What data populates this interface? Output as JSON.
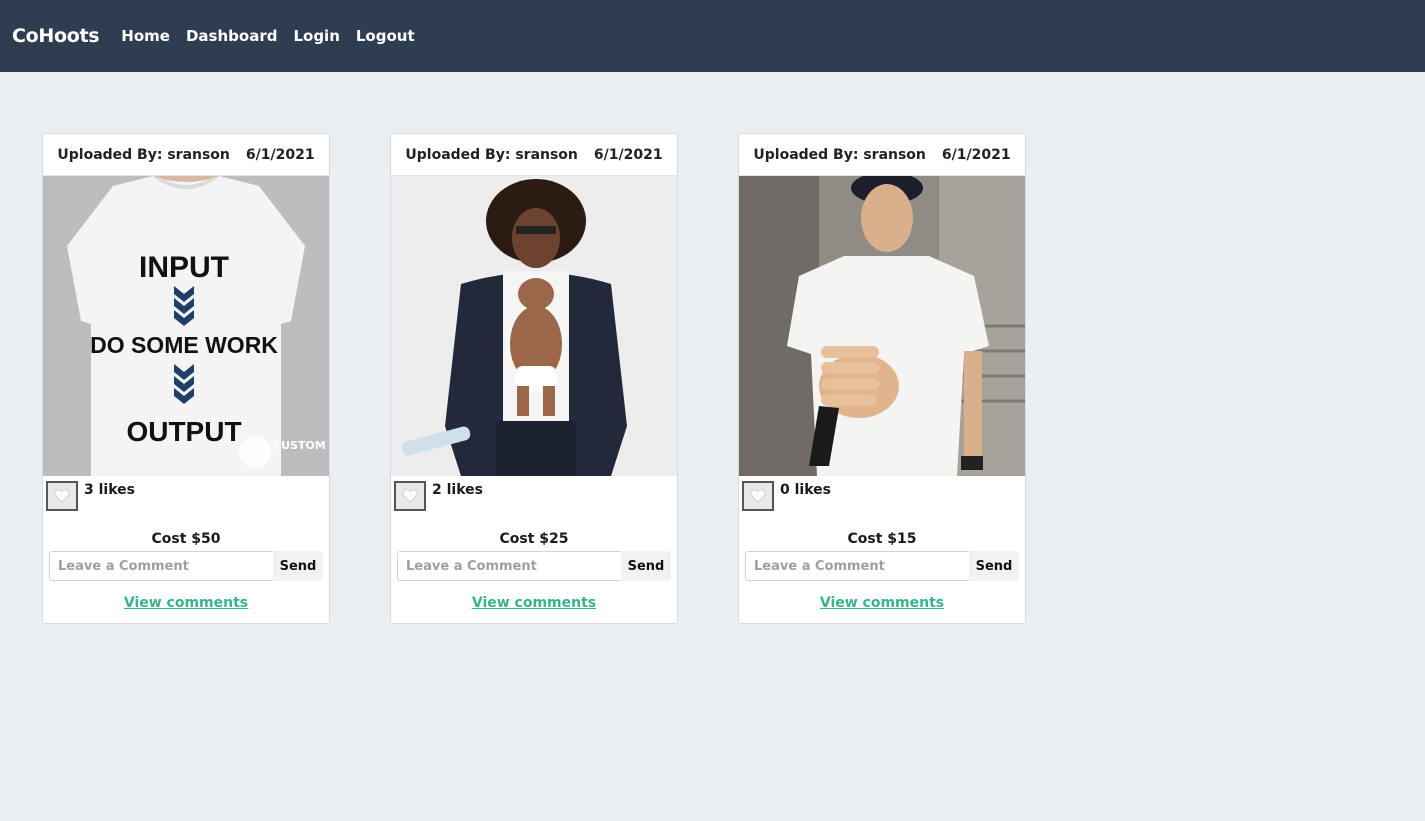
{
  "nav": {
    "brand": "CoHoots",
    "links": [
      "Home",
      "Dashboard",
      "Login",
      "Logout"
    ]
  },
  "cards": [
    {
      "uploaded_by": "Uploaded By: sranson",
      "date": "6/1/2021",
      "shirt_lines": [
        "INPUT",
        "DO SOME WORK",
        "OUTPUT"
      ],
      "watermark": "CUSTOM INK",
      "likes": "3 likes",
      "cost": "Cost $50",
      "comment_placeholder": "Leave a Comment",
      "send_label": "Send",
      "view_comments": "View comments"
    },
    {
      "uploaded_by": "Uploaded By: sranson",
      "date": "6/1/2021",
      "likes": "2 likes",
      "cost": "Cost $25",
      "comment_placeholder": "Leave a Comment",
      "send_label": "Send",
      "view_comments": "View comments"
    },
    {
      "uploaded_by": "Uploaded By: sranson",
      "date": "6/1/2021",
      "likes": "0 likes",
      "cost": "Cost $15",
      "comment_placeholder": "Leave a Comment",
      "send_label": "Send",
      "view_comments": "View comments"
    }
  ],
  "colors": {
    "navbar": "#2e3e50",
    "page_bg": "#ebeff2",
    "link_accent": "#3ab38a"
  },
  "icons": {
    "like": "heart-icon"
  }
}
